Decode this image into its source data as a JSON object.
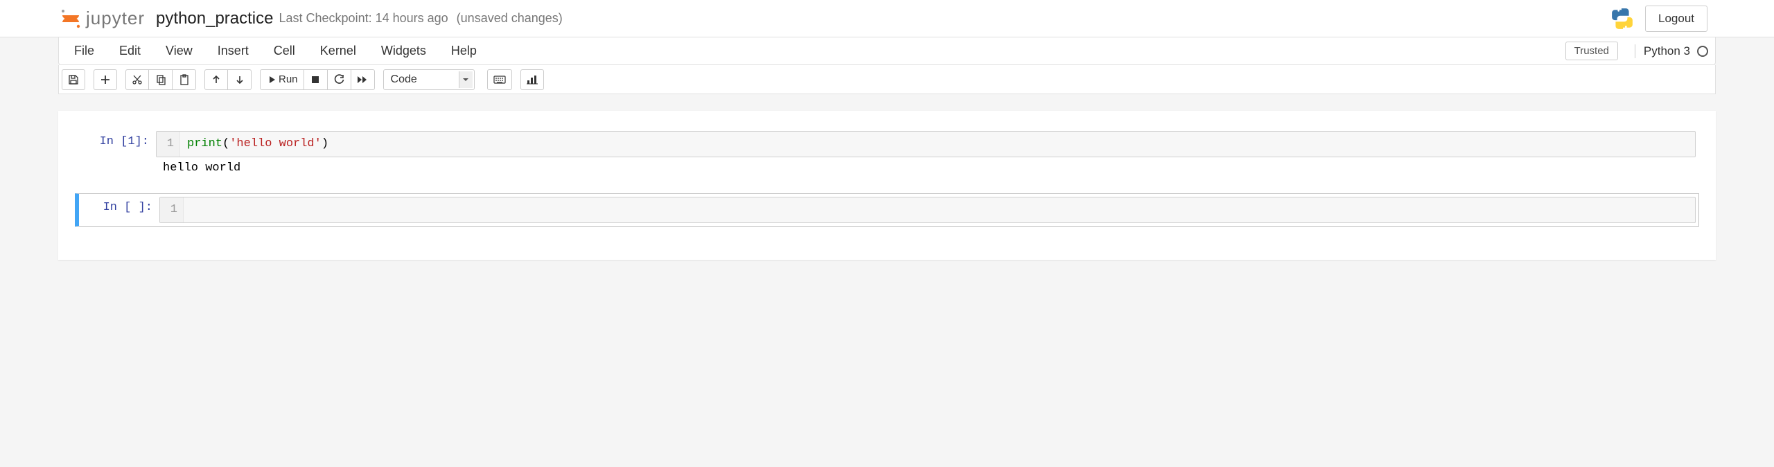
{
  "header": {
    "logo_text": "jupyter",
    "notebook_title": "python_practice",
    "checkpoint_text": "Last Checkpoint: 14 hours ago",
    "unsaved_text": "(unsaved changes)",
    "logout_label": "Logout"
  },
  "menubar": {
    "items": [
      "File",
      "Edit",
      "View",
      "Insert",
      "Cell",
      "Kernel",
      "Widgets",
      "Help"
    ],
    "trusted_label": "Trusted",
    "kernel_label": "Python 3"
  },
  "toolbar": {
    "run_label": "Run",
    "cell_type": "Code"
  },
  "cells": [
    {
      "prompt": "In [1]:",
      "line_number": "1",
      "code_fn": "print",
      "code_open": "(",
      "code_str": "'hello world'",
      "code_close": ")",
      "output": "hello world"
    },
    {
      "prompt": "In [ ]:",
      "line_number": "1"
    }
  ]
}
